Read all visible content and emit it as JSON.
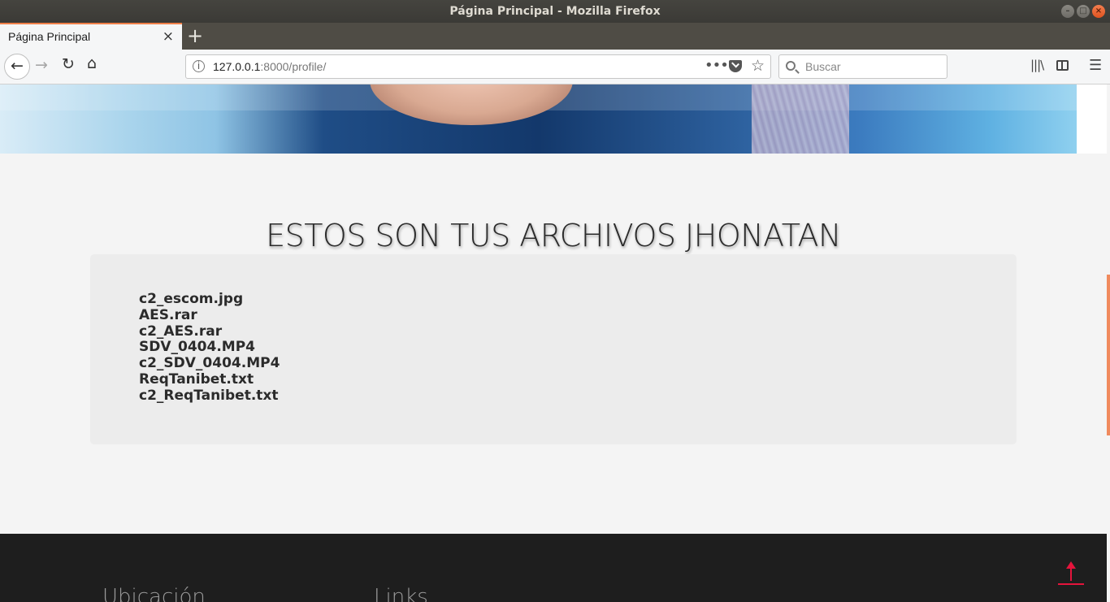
{
  "window": {
    "title": "Página Principal - Mozilla Firefox",
    "controls": [
      "–",
      "□",
      "×"
    ]
  },
  "tabs": [
    {
      "label": "Página Principal",
      "close": "×"
    }
  ],
  "new_tab_label": "+",
  "navigation": {
    "back_icon": "arrow-left-icon",
    "forward_icon": "arrow-right-icon",
    "reload_icon": "reload-icon",
    "home_icon": "home-icon",
    "url_host": "127.0.0.1",
    "url_rest": ":8000/profile/",
    "page_actions": "•••",
    "search_placeholder": "Buscar"
  },
  "main": {
    "heading": "ESTOS SON TUS ARCHIVOS JHONATAN",
    "files": [
      "c2_escom.jpg",
      "AES.rar",
      "c2_AES.rar",
      "SDV_0404.MP4",
      "c2_SDV_0404.MP4",
      "ReqTanibet.txt",
      "c2_ReqTanibet.txt"
    ]
  },
  "footer": {
    "columns": [
      "Ubicación",
      "Links"
    ]
  },
  "colors": {
    "accent": "#f08049",
    "back_to_top": "#e4143c",
    "footer_bg": "#1e1e1e",
    "card_bg": "#ececec"
  }
}
